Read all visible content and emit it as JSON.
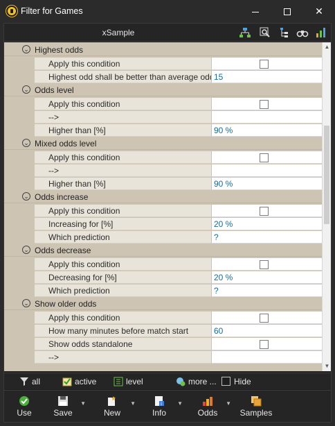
{
  "window": {
    "title": "Filter for Games"
  },
  "toolbar": {
    "title": "xSample",
    "icons": [
      "hierarchy-icon",
      "search-settings-icon",
      "tree-icon",
      "binoculars-icon",
      "bar-chart-icon"
    ]
  },
  "sections": [
    {
      "label": "Highest odds",
      "rows": [
        {
          "name": "Apply this condition",
          "type": "checkbox",
          "checked": false
        },
        {
          "name": "Highest odd shall be better than average odd by",
          "type": "text",
          "value": "15"
        }
      ]
    },
    {
      "label": "Odds level",
      "rows": [
        {
          "name": "Apply this condition",
          "type": "checkbox",
          "checked": false
        },
        {
          "name": "-->",
          "type": "text",
          "value": ""
        },
        {
          "name": "Higher than [%]",
          "type": "text",
          "value": "90 %"
        }
      ]
    },
    {
      "label": "Mixed odds level",
      "rows": [
        {
          "name": "Apply this condition",
          "type": "checkbox",
          "checked": false
        },
        {
          "name": "-->",
          "type": "text",
          "value": ""
        },
        {
          "name": "Higher than [%]",
          "type": "text",
          "value": "90 %"
        }
      ]
    },
    {
      "label": "Odds increase",
      "rows": [
        {
          "name": "Apply this condition",
          "type": "checkbox",
          "checked": false
        },
        {
          "name": "Increasing for [%]",
          "type": "text",
          "value": "20 %"
        },
        {
          "name": "Which prediction",
          "type": "text",
          "value": "?"
        }
      ]
    },
    {
      "label": "Odds decrease",
      "rows": [
        {
          "name": "Apply this condition",
          "type": "checkbox",
          "checked": false
        },
        {
          "name": "Decreasing for [%]",
          "type": "text",
          "value": "20 %"
        },
        {
          "name": "Which prediction",
          "type": "text",
          "value": "?"
        }
      ]
    },
    {
      "label": "Show older odds",
      "rows": [
        {
          "name": "Apply this condition",
          "type": "checkbox",
          "checked": false
        },
        {
          "name": "How many minutes before match start",
          "type": "text",
          "value": "60"
        },
        {
          "name": "Show odds standalone",
          "type": "checkbox",
          "checked": false
        },
        {
          "name": "-->",
          "type": "text",
          "value": ""
        }
      ]
    }
  ],
  "filterbar": {
    "all": "all",
    "active": "active",
    "level": "level",
    "more": "more ...",
    "hide": "Hide",
    "hide_checked": false
  },
  "actions": {
    "use": "Use",
    "save": "Save",
    "new": "New",
    "info": "Info",
    "odds": "Odds",
    "samples": "Samples"
  },
  "colors": {
    "category_bg": "#cdc4b4",
    "name_bg": "#e9e4d9",
    "value_text": "#1a6a9a",
    "chrome": "#252526"
  }
}
